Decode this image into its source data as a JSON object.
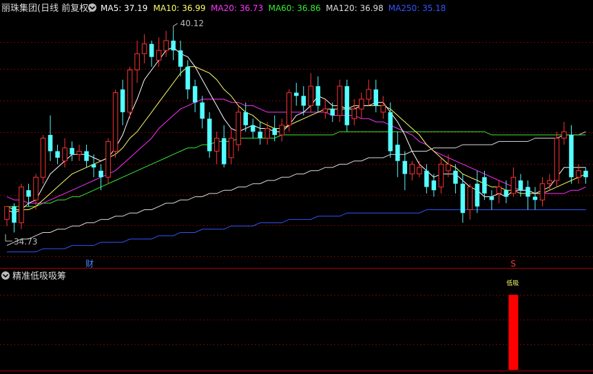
{
  "header": {
    "title": "丽珠集团(日线 前复权)",
    "dropdown_icon": "chevron-down-icon",
    "ma_items": [
      {
        "label": "MA5: 37.19",
        "color": "#ffffff"
      },
      {
        "label": "MA10: 36.99",
        "color": "#ffff66"
      },
      {
        "label": "MA20: 36.73",
        "color": "#ff33ff"
      },
      {
        "label": "MA60: 36.86",
        "color": "#33ee33"
      },
      {
        "label": "MA120: 36.98",
        "color": "#dddddd"
      },
      {
        "label": "MA250: 35.18",
        "color": "#3355ff"
      }
    ]
  },
  "annotations": {
    "high_label": "40.12",
    "low_label": "34.73",
    "marker_cai": "财",
    "marker_s": "S"
  },
  "sub_panel": {
    "title": "精准低吸吸筹",
    "dropdown_icon": "chevron-down-icon",
    "signal_label": "低吸",
    "signal_color": "#ff0000",
    "signal_value": 1
  },
  "colors": {
    "background": "#000000",
    "up_candle": "#ff3333",
    "down_candle": "#54ffff",
    "grid_line": "#7a0000",
    "panel_border": "#aa0000"
  },
  "chart_data": {
    "type": "candlestick",
    "y_high": 40.12,
    "y_low": 34.73,
    "candles": [
      [
        34.3,
        34.7,
        34.1,
        34.5
      ],
      [
        34.7,
        34.2,
        33.9,
        34.8
      ],
      [
        34.2,
        35.3,
        34.0,
        35.4
      ],
      [
        35.2,
        35.0,
        34.7,
        35.4
      ],
      [
        34.9,
        35.6,
        34.6,
        35.7
      ],
      [
        35.6,
        36.8,
        35.4,
        36.9
      ],
      [
        36.9,
        36.4,
        36.1,
        37.5
      ],
      [
        36.4,
        36.2,
        36.0,
        36.6
      ],
      [
        36.1,
        36.5,
        35.9,
        36.8
      ],
      [
        36.5,
        36.3,
        36.1,
        36.7
      ],
      [
        36.3,
        36.4,
        36.1,
        36.6
      ],
      [
        36.4,
        36.1,
        35.9,
        36.6
      ],
      [
        36.0,
        35.9,
        35.6,
        36.3
      ],
      [
        35.8,
        35.6,
        35.2,
        36.0
      ],
      [
        35.6,
        36.7,
        35.4,
        36.8
      ],
      [
        36.4,
        38.2,
        36.2,
        38.3
      ],
      [
        38.3,
        37.6,
        37.2,
        38.6
      ],
      [
        37.6,
        38.9,
        37.4,
        39.0
      ],
      [
        38.9,
        39.4,
        38.5,
        39.8
      ],
      [
        39.4,
        39.7,
        39.1,
        40.0
      ],
      [
        39.7,
        39.3,
        39.0,
        39.8
      ],
      [
        39.2,
        39.5,
        39.0,
        39.9
      ],
      [
        39.5,
        39.8,
        39.3,
        40.1
      ],
      [
        39.8,
        39.5,
        39.2,
        40.12
      ],
      [
        39.5,
        39.0,
        38.7,
        39.8
      ],
      [
        39.0,
        38.3,
        38.0,
        39.2
      ],
      [
        38.4,
        37.9,
        37.6,
        38.6
      ],
      [
        37.9,
        37.4,
        37.1,
        38.1
      ],
      [
        37.4,
        36.4,
        36.2,
        37.6
      ],
      [
        36.4,
        36.8,
        36.0,
        37.0
      ],
      [
        36.8,
        36.0,
        35.9,
        37.2
      ],
      [
        36.2,
        36.8,
        36.0,
        37.1
      ],
      [
        36.6,
        37.6,
        36.4,
        37.8
      ],
      [
        37.6,
        37.2,
        37.0,
        37.9
      ],
      [
        37.2,
        37.0,
        36.8,
        37.4
      ],
      [
        37.0,
        36.8,
        36.6,
        37.3
      ],
      [
        36.8,
        37.1,
        36.6,
        37.3
      ],
      [
        37.1,
        36.9,
        36.7,
        37.5
      ],
      [
        36.9,
        37.2,
        36.7,
        37.4
      ],
      [
        37.2,
        38.2,
        37.0,
        38.3
      ],
      [
        38.2,
        38.1,
        37.8,
        38.5
      ],
      [
        38.1,
        37.8,
        37.5,
        38.4
      ],
      [
        37.8,
        38.4,
        37.6,
        38.8
      ],
      [
        38.4,
        37.8,
        37.6,
        38.7
      ],
      [
        37.6,
        37.7,
        37.4,
        38.0
      ],
      [
        37.7,
        37.5,
        37.3,
        37.9
      ],
      [
        37.5,
        38.4,
        37.3,
        38.6
      ],
      [
        38.4,
        37.2,
        37.0,
        38.6
      ],
      [
        37.4,
        37.7,
        37.2,
        38.0
      ],
      [
        37.7,
        38.0,
        37.4,
        38.2
      ],
      [
        38.0,
        38.3,
        37.8,
        38.6
      ],
      [
        38.3,
        37.8,
        37.6,
        38.6
      ],
      [
        37.6,
        37.8,
        37.4,
        38.1
      ],
      [
        37.6,
        36.4,
        36.2,
        37.9
      ],
      [
        36.6,
        36.1,
        35.6,
        37.0
      ],
      [
        36.1,
        35.7,
        35.2,
        36.4
      ],
      [
        35.7,
        36.0,
        35.5,
        36.1
      ],
      [
        35.7,
        35.9,
        35.6,
        36.1
      ],
      [
        35.8,
        35.3,
        35.1,
        36.0
      ],
      [
        35.5,
        35.2,
        35.0,
        35.7
      ],
      [
        35.3,
        36.0,
        35.1,
        36.2
      ],
      [
        35.8,
        36.0,
        35.6,
        36.3
      ],
      [
        35.8,
        35.4,
        35.1,
        36.0
      ],
      [
        35.4,
        34.5,
        34.2,
        35.7
      ],
      [
        34.6,
        35.3,
        34.3,
        35.4
      ],
      [
        35.4,
        34.7,
        34.5,
        35.8
      ],
      [
        35.6,
        35.1,
        34.9,
        35.8
      ],
      [
        35.0,
        34.9,
        34.6,
        35.2
      ],
      [
        35.1,
        35.3,
        34.8,
        35.5
      ],
      [
        35.2,
        35.0,
        34.8,
        35.5
      ],
      [
        35.1,
        35.6,
        35.0,
        35.9
      ],
      [
        35.5,
        35.2,
        35.0,
        35.7
      ],
      [
        35.3,
        35.0,
        34.6,
        35.5
      ],
      [
        35.0,
        34.9,
        34.6,
        35.3
      ],
      [
        34.9,
        35.4,
        34.7,
        35.6
      ],
      [
        35.4,
        35.5,
        35.2,
        35.7
      ],
      [
        35.5,
        36.8,
        35.3,
        37.0
      ],
      [
        36.8,
        37.0,
        36.6,
        37.3
      ],
      [
        36.9,
        35.6,
        35.4,
        37.2
      ],
      [
        35.6,
        35.8,
        35.4,
        36.0
      ],
      [
        35.8,
        35.6,
        35.4,
        35.9
      ]
    ],
    "ma5": [
      34.6,
      34.5,
      34.6,
      34.8,
      34.9,
      35.3,
      35.7,
      35.9,
      36.1,
      36.3,
      36.3,
      36.3,
      36.2,
      36.1,
      36.2,
      36.5,
      36.9,
      37.5,
      38.0,
      38.6,
      38.9,
      39.2,
      39.5,
      39.6,
      39.4,
      39.3,
      39.0,
      38.6,
      38.2,
      37.8,
      37.4,
      37.1,
      37.0,
      37.1,
      37.2,
      37.1,
      37.1,
      37.0,
      37.0,
      37.2,
      37.5,
      37.6,
      37.8,
      38.1,
      38.0,
      37.8,
      37.8,
      37.7,
      37.7,
      37.8,
      37.8,
      37.9,
      37.9,
      37.6,
      37.3,
      36.9,
      36.4,
      36.0,
      35.8,
      35.6,
      35.7,
      35.7,
      35.7,
      35.5,
      35.3,
      35.2,
      35.0,
      35.0,
      35.1,
      35.0,
      35.2,
      35.2,
      35.2,
      35.1,
      35.2,
      35.3,
      35.6,
      35.9,
      35.9,
      35.9,
      35.9
    ],
    "ma10": [
      34.7,
      34.6,
      34.6,
      34.6,
      34.7,
      34.9,
      35.1,
      35.3,
      35.5,
      35.7,
      35.8,
      35.9,
      36.0,
      36.1,
      36.2,
      36.3,
      36.5,
      36.8,
      37.0,
      37.3,
      37.6,
      37.9,
      38.2,
      38.5,
      38.8,
      39.0,
      39.0,
      38.9,
      38.8,
      38.6,
      38.3,
      38.1,
      37.8,
      37.6,
      37.5,
      37.3,
      37.2,
      37.1,
      37.1,
      37.2,
      37.3,
      37.4,
      37.5,
      37.6,
      37.7,
      37.7,
      37.7,
      37.7,
      37.8,
      37.8,
      37.8,
      37.8,
      37.8,
      37.7,
      37.5,
      37.3,
      37.1,
      36.9,
      36.6,
      36.4,
      36.2,
      36.0,
      35.9,
      35.7,
      35.6,
      35.5,
      35.4,
      35.3,
      35.3,
      35.2,
      35.2,
      35.1,
      35.1,
      35.1,
      35.1,
      35.2,
      35.3,
      35.4,
      35.5,
      35.6,
      35.7
    ],
    "ma20": [
      35.0,
      34.9,
      34.9,
      34.8,
      34.8,
      34.8,
      34.9,
      35.0,
      35.1,
      35.2,
      35.3,
      35.4,
      35.5,
      35.6,
      35.7,
      35.8,
      36.0,
      36.2,
      36.4,
      36.6,
      36.8,
      37.1,
      37.3,
      37.5,
      37.7,
      37.8,
      37.9,
      38.0,
      38.0,
      38.0,
      38.0,
      37.9,
      37.9,
      37.8,
      37.8,
      37.7,
      37.6,
      37.6,
      37.6,
      37.6,
      37.6,
      37.6,
      37.6,
      37.6,
      37.6,
      37.5,
      37.5,
      37.5,
      37.5,
      37.4,
      37.4,
      37.3,
      37.3,
      37.2,
      37.1,
      37.0,
      36.9,
      36.7,
      36.6,
      36.4,
      36.3,
      36.2,
      36.1,
      36.0,
      35.9,
      35.8,
      35.7,
      35.6,
      35.5,
      35.4,
      35.3,
      35.2,
      35.2,
      35.1,
      35.1,
      35.1,
      35.1,
      35.1,
      35.2,
      35.2,
      35.3
    ],
    "ma60": [
      34.7,
      34.7,
      34.7,
      34.7,
      34.7,
      34.8,
      34.8,
      34.9,
      34.9,
      35.0,
      35.0,
      35.1,
      35.2,
      35.3,
      35.4,
      35.5,
      35.6,
      35.7,
      35.8,
      35.9,
      36.0,
      36.1,
      36.2,
      36.3,
      36.4,
      36.5,
      36.5,
      36.6,
      36.6,
      36.7,
      36.7,
      36.7,
      36.8,
      36.8,
      36.8,
      36.8,
      36.8,
      36.8,
      36.9,
      36.9,
      36.9,
      36.9,
      36.9,
      36.9,
      36.9,
      36.9,
      37.0,
      37.0,
      37.0,
      37.0,
      37.0,
      37.0,
      37.0,
      37.0,
      37.0,
      37.0,
      37.0,
      37.0,
      37.0,
      37.0,
      37.0,
      37.0,
      37.0,
      37.0,
      37.0,
      37.0,
      37.0,
      36.9,
      36.9,
      36.9,
      36.9,
      36.9,
      36.9,
      36.9,
      36.9,
      36.9,
      36.9,
      36.9,
      36.9,
      36.9,
      36.9
    ],
    "ma120": [
      33.5,
      33.6,
      33.7,
      33.7,
      33.8,
      33.9,
      33.9,
      34.0,
      34.0,
      34.1,
      34.1,
      34.2,
      34.2,
      34.3,
      34.3,
      34.4,
      34.4,
      34.5,
      34.5,
      34.6,
      34.6,
      34.7,
      34.8,
      34.8,
      34.9,
      34.9,
      35.0,
      35.0,
      35.1,
      35.1,
      35.2,
      35.2,
      35.3,
      35.3,
      35.4,
      35.4,
      35.5,
      35.5,
      35.6,
      35.6,
      35.7,
      35.7,
      35.8,
      35.8,
      35.9,
      35.9,
      36.0,
      36.0,
      36.1,
      36.1,
      36.2,
      36.2,
      36.2,
      36.3,
      36.3,
      36.3,
      36.4,
      36.4,
      36.4,
      36.5,
      36.5,
      36.5,
      36.5,
      36.6,
      36.6,
      36.6,
      36.6,
      36.6,
      36.7,
      36.7,
      36.7,
      36.7,
      36.7,
      36.8,
      36.8,
      36.8,
      36.8,
      36.9,
      36.9,
      36.9,
      37.0
    ],
    "ma250": [
      33.3,
      33.3,
      33.3,
      33.3,
      33.3,
      33.4,
      33.4,
      33.4,
      33.4,
      33.5,
      33.5,
      33.5,
      33.5,
      33.6,
      33.6,
      33.6,
      33.6,
      33.7,
      33.7,
      33.7,
      33.7,
      33.8,
      33.8,
      33.8,
      33.9,
      33.9,
      33.9,
      34.0,
      34.0,
      34.0,
      34.0,
      34.1,
      34.1,
      34.1,
      34.1,
      34.2,
      34.2,
      34.2,
      34.2,
      34.3,
      34.3,
      34.3,
      34.3,
      34.4,
      34.4,
      34.4,
      34.4,
      34.5,
      34.5,
      34.5,
      34.5,
      34.5,
      34.5,
      34.5,
      34.5,
      34.5,
      34.5,
      34.5,
      34.6,
      34.6,
      34.6,
      34.6,
      34.6,
      34.6,
      34.6,
      34.6,
      34.6,
      34.6,
      34.6,
      34.6,
      34.6,
      34.6,
      34.6,
      34.6,
      34.6,
      34.6,
      34.6,
      34.6,
      34.6,
      34.6,
      34.6
    ],
    "signal_index": 70
  }
}
